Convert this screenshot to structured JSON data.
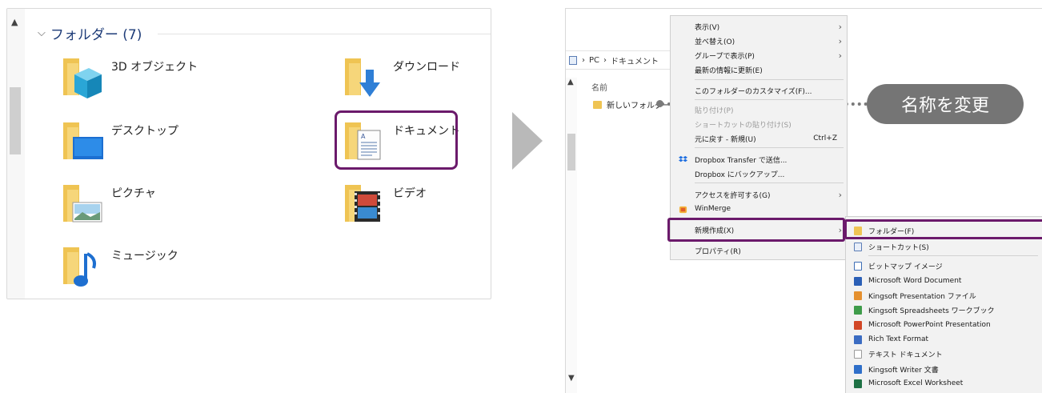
{
  "left": {
    "group_title": "フォルダー (7)",
    "folders": [
      {
        "label": "3D オブジェクト",
        "icon": "3d-objects-icon"
      },
      {
        "label": "ダウンロード",
        "icon": "download-icon"
      },
      {
        "label": "デスクトップ",
        "icon": "desktop-icon"
      },
      {
        "label": "ドキュメント",
        "icon": "document-icon"
      },
      {
        "label": "ピクチャ",
        "icon": "picture-icon"
      },
      {
        "label": "ビデオ",
        "icon": "video-icon"
      },
      {
        "label": "ミュージック",
        "icon": "music-icon"
      }
    ]
  },
  "right": {
    "breadcrumb": [
      "PC",
      "ドキュメント"
    ],
    "column_header": "名前",
    "new_folder_label": "新しいフォルダー",
    "callout": "名称を変更",
    "context_menu": [
      {
        "label": "表示(V)",
        "submenu": true
      },
      {
        "label": "並べ替え(O)",
        "submenu": true
      },
      {
        "label": "グループで表示(P)",
        "submenu": true
      },
      {
        "label": "最新の情報に更新(E)"
      },
      {
        "label": "このフォルダーのカスタマイズ(F)..."
      },
      {
        "label": "貼り付け(P)",
        "disabled": true
      },
      {
        "label": "ショートカットの貼り付け(S)",
        "disabled": true
      },
      {
        "label": "元に戻す - 新規(U)",
        "shortcut": "Ctrl+Z"
      },
      {
        "label": "Dropbox Transfer で送信..."
      },
      {
        "label": "Dropbox にバックアップ..."
      },
      {
        "label": "アクセスを許可する(G)",
        "submenu": true
      },
      {
        "label": "WinMerge"
      },
      {
        "label": "新規作成(X)",
        "submenu": true
      },
      {
        "label": "プロパティ(R)"
      }
    ],
    "new_submenu": [
      {
        "label": "フォルダー(F)"
      },
      {
        "label": "ショートカット(S)"
      },
      {
        "label": "ビットマップ イメージ"
      },
      {
        "label": "Microsoft Word Document"
      },
      {
        "label": "Kingsoft Presentation ファイル"
      },
      {
        "label": "Kingsoft Spreadsheets ワークブック"
      },
      {
        "label": "Microsoft PowerPoint Presentation"
      },
      {
        "label": "Rich Text Format"
      },
      {
        "label": "テキスト ドキュメント"
      },
      {
        "label": "Kingsoft Writer 文書"
      },
      {
        "label": "Microsoft Excel Worksheet"
      }
    ]
  },
  "colors": {
    "highlight": "#6b1a6b",
    "callout_bg": "#757575",
    "group_title": "#1e3c78"
  }
}
